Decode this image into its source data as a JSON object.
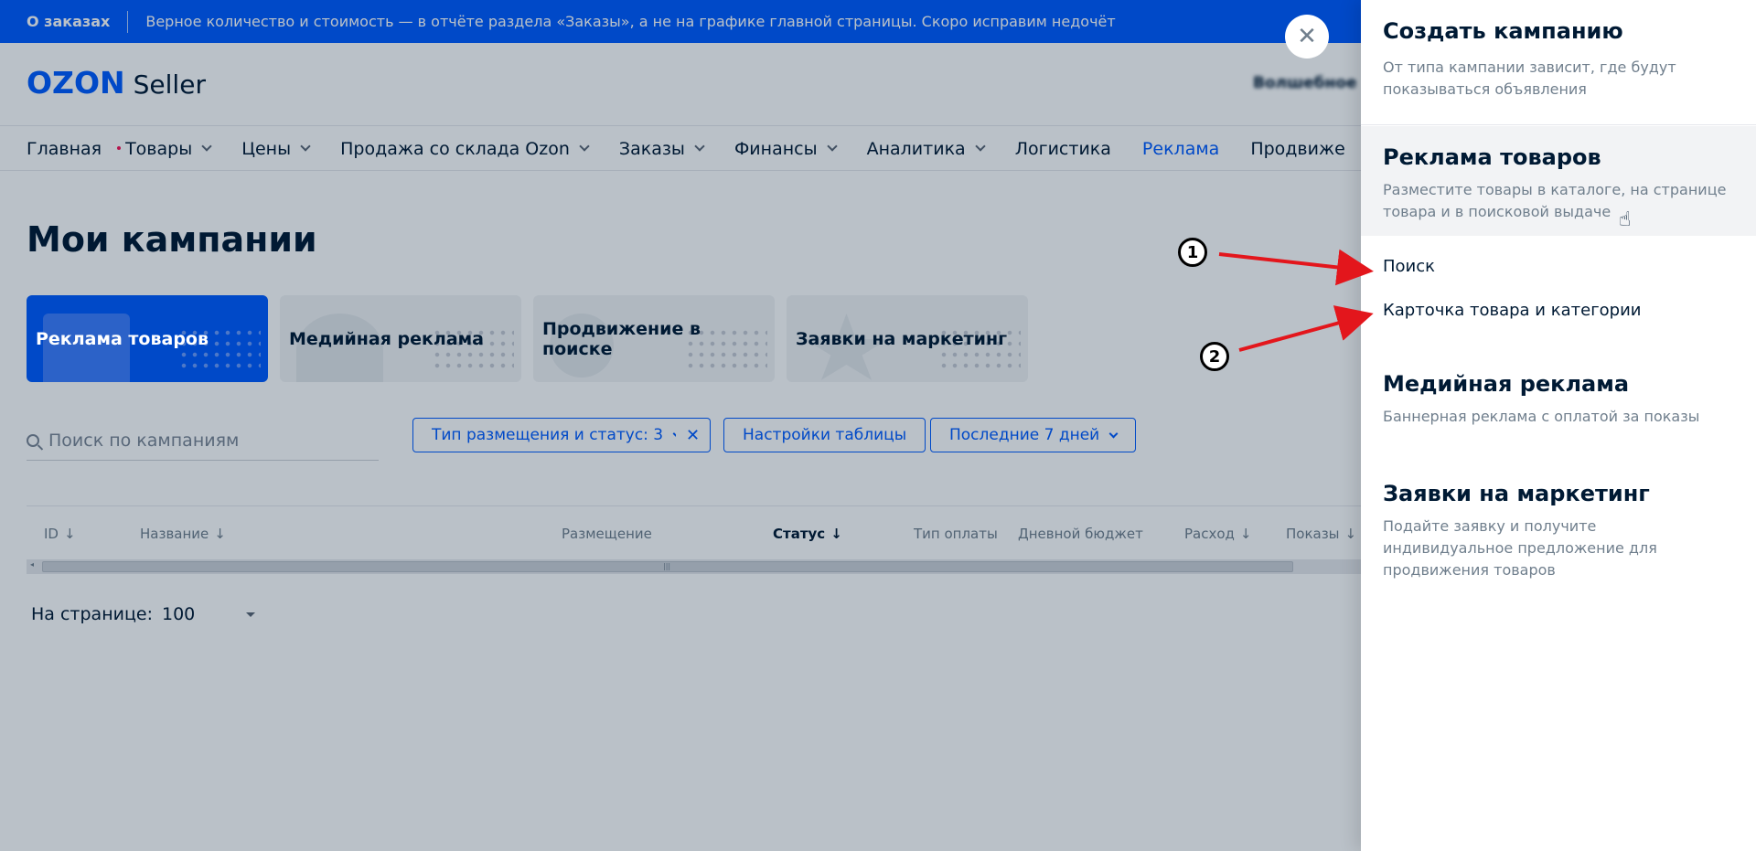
{
  "banner": {
    "title": "О заказах",
    "text": "Верное количество и стоимость — в отчёте раздела «Заказы», а не на графике главной страницы. Скоро исправим недочёт"
  },
  "header": {
    "logo_brand": "OZON",
    "logo_product": "Seller",
    "user_name": "Волшебное"
  },
  "nav": {
    "items": [
      {
        "label": "Главная"
      },
      {
        "label": "Товары"
      },
      {
        "label": "Цены"
      },
      {
        "label": "Продажа со склада Ozon"
      },
      {
        "label": "Заказы"
      },
      {
        "label": "Финансы"
      },
      {
        "label": "Аналитика"
      },
      {
        "label": "Логистика"
      },
      {
        "label": "Реклама"
      },
      {
        "label": "Продвиже"
      }
    ]
  },
  "page": {
    "title": "Мои кампании",
    "cards": [
      {
        "label": "Реклама товаров"
      },
      {
        "label": "Медийная реклама"
      },
      {
        "label": "Продвижение в поиске"
      },
      {
        "label": "Заявки на маркетинг"
      }
    ],
    "search_placeholder": "Поиск по кампаниям",
    "filters": {
      "placement_status": "Тип размещения и статус: 3",
      "clear": "✕",
      "table_settings": "Настройки таблицы",
      "period": "Последние 7 дней"
    },
    "table_headers": {
      "id": "ID",
      "name": "Название",
      "placement": "Размещение",
      "status": "Статус",
      "payment_type": "Тип оплаты",
      "daily_budget": "Дневной бюджет",
      "spend": "Расход",
      "impressions": "Показы"
    },
    "per_page_label": "На странице:",
    "per_page_value": "100"
  },
  "drawer": {
    "close": "✕",
    "title": "Создать кампанию",
    "subtitle": "От типа кампании зависит, где будут показываться объявления",
    "sections": [
      {
        "title": "Реклама товаров",
        "subtitle": "Разместите товары в каталоге, на странице товара и в поисковой выдаче",
        "items": [
          "Поиск",
          "Карточка товара и категории"
        ]
      },
      {
        "title": "Медийная реклама",
        "subtitle": "Баннерная реклама с оплатой за показы"
      },
      {
        "title": "Заявки на маркетинг",
        "subtitle": "Подайте заявку и получите индивидуальное предложение для продвижения товаров"
      }
    ]
  },
  "annotations": {
    "marker_1": "1",
    "marker_2": "2",
    "arrow_color": "#e3161c"
  },
  "colors": {
    "accent": "#005bff",
    "overlay": "#001a34"
  }
}
